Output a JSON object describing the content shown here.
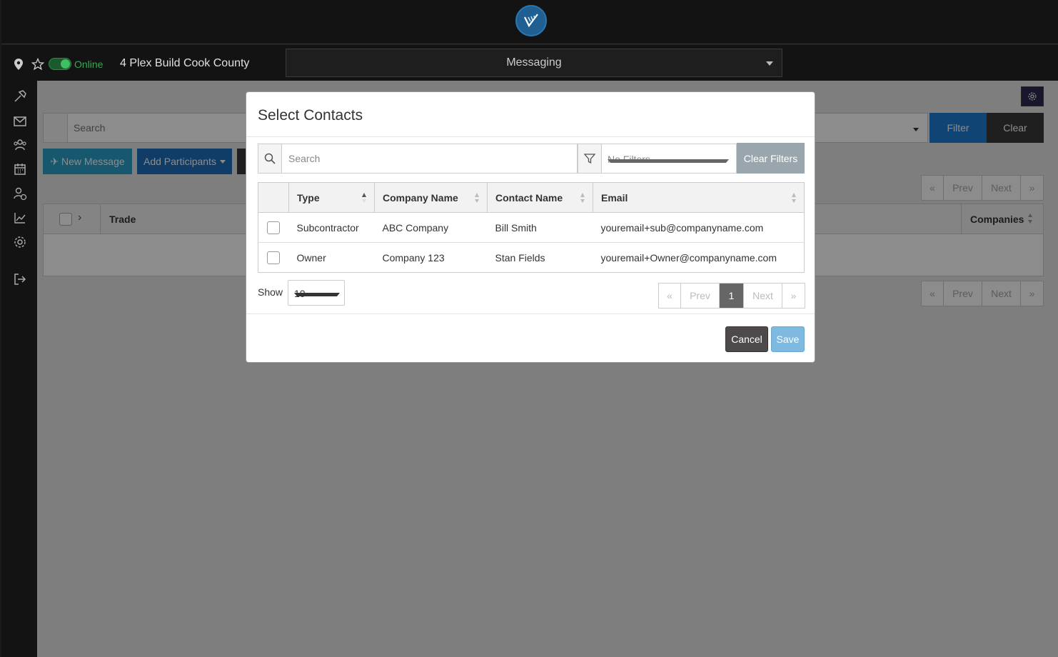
{
  "header": {
    "logo_icon": "app-logo-icon",
    "status": "Online",
    "project_name": "4 Plex Build Cook County",
    "module": "Messaging"
  },
  "sidebar": {
    "items": [
      {
        "icon": "hammer-icon"
      },
      {
        "icon": "mail-icon"
      },
      {
        "icon": "users-icon"
      },
      {
        "icon": "calendar-icon"
      },
      {
        "icon": "user-clock-icon"
      },
      {
        "icon": "chart-icon"
      },
      {
        "icon": "gear-icon"
      },
      {
        "icon": "logout-icon"
      }
    ]
  },
  "background": {
    "search_placeholder": "Search",
    "filter_label": "Filter",
    "clear_label": "Clear",
    "new_message_label": "New Message",
    "add_participants_label": "Add Participants",
    "pager": [
      "«",
      "Prev",
      "Next",
      "»"
    ],
    "table": {
      "col_trade": "Trade",
      "col_companies": "Companies"
    }
  },
  "modal": {
    "title": "Select Contacts",
    "search_placeholder": "Search",
    "filters_value": "No Filters",
    "clear_filters_label": "Clear Filters",
    "columns": [
      "Type",
      "Company Name",
      "Contact Name",
      "Email"
    ],
    "rows": [
      {
        "type": "Subcontractor",
        "company": "ABC Company",
        "contact": "Bill Smith",
        "email": "youremail+sub@companyname.com"
      },
      {
        "type": "Owner",
        "company": "Company 123",
        "contact": "Stan Fields",
        "email": "youremail+Owner@companyname.com"
      }
    ],
    "show_label": "Show",
    "show_value": "10",
    "pager": {
      "first": "«",
      "prev": "Prev",
      "page": "1",
      "next": "Next",
      "last": "»"
    },
    "cancel_label": "Cancel",
    "save_label": "Save"
  },
  "colors": {
    "subcontractor": "#7d4fc2",
    "owner": "#d9392b",
    "online": "#3aa655",
    "primary": "#1c7cd5"
  }
}
